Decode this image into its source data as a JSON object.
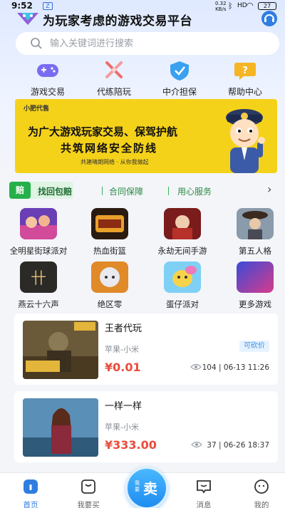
{
  "status_bar": {
    "time": "9:52",
    "sim_label": "Z",
    "net_rate": "0.32",
    "net_unit": "KB/s",
    "battery": "27"
  },
  "header": {
    "slogan": "为玩家考虑的游戏交易平台",
    "logo_icon": "diamond-logo",
    "service_icon": "headset-icon"
  },
  "search": {
    "placeholder": "输入关键词进行搜索"
  },
  "quick_links": [
    {
      "label": "游戏交易",
      "icon": "gamepad-icon"
    },
    {
      "label": "代练陪玩",
      "icon": "crossed-swords-icon"
    },
    {
      "label": "中介担保",
      "icon": "shield-check-icon"
    },
    {
      "label": "帮助中心",
      "icon": "help-question-icon"
    }
  ],
  "banner": {
    "brand": "小肥代售",
    "line1": "为广大游戏玩家交易、保驾护航",
    "line2": "共筑网络安全防线",
    "line3": "共建晴朗网络 · 从你我做起"
  },
  "guarantee": {
    "badge": "赔",
    "item1": "找回包赔",
    "item2": "合同保障",
    "item3": "用心服务"
  },
  "games": [
    {
      "label": "全明星街球派对"
    },
    {
      "label": "热血街篮"
    },
    {
      "label": "永劫无间手游"
    },
    {
      "label": "第五人格"
    },
    {
      "label": "燕云十六声"
    },
    {
      "label": "绝区零"
    },
    {
      "label": "蛋仔派对"
    },
    {
      "label": "更多游戏"
    }
  ],
  "listings": [
    {
      "title": "王者代玩",
      "platform": "苹果-小米",
      "tag": "可砍价",
      "price": "¥0.01",
      "views": "104",
      "date": "06-13 11:26"
    },
    {
      "title": "一样一样",
      "platform": "苹果-小米",
      "price": "¥333.00",
      "views": "37",
      "date": "06-26 18:37"
    }
  ],
  "tabbar": {
    "home": "首页",
    "buy": "我要买",
    "sell_small": "我要",
    "sell": "卖",
    "messages": "消息",
    "mine": "我的"
  },
  "colors": {
    "accent": "#2f7de1",
    "price": "#e84c3d",
    "guarantee_green": "#26b04a",
    "banner_yellow": "#f5d21a"
  }
}
